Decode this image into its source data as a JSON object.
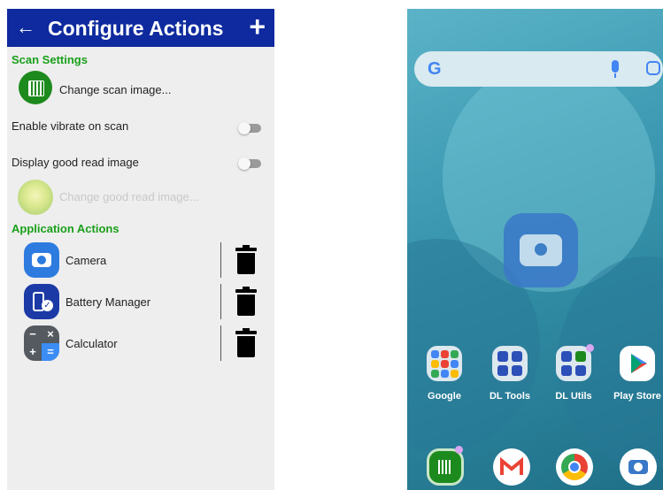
{
  "left_app": {
    "title": "Configure Actions",
    "back_icon": "←",
    "add_icon": "+",
    "scan_settings": {
      "header": "Scan Settings",
      "change_scan_image": "Change scan image...",
      "enable_vibrate": {
        "label": "Enable vibrate on scan",
        "on": false
      },
      "display_good_read": {
        "label": "Display good read image",
        "on": false
      },
      "change_good_read_image": "Change good read image..."
    },
    "application_actions": {
      "header": "Application Actions",
      "items": [
        {
          "label": "Camera",
          "icon": "camera-icon"
        },
        {
          "label": "Battery Manager",
          "icon": "battery-manager-icon"
        },
        {
          "label": "Calculator",
          "icon": "calculator-icon"
        }
      ]
    },
    "colors": {
      "appbar": "#0e2a9e",
      "section_header": "#1aa01a"
    }
  },
  "right_home": {
    "search_logo": "G",
    "apps": [
      {
        "label": "Google"
      },
      {
        "label": "DL Tools"
      },
      {
        "label": "DL Utils"
      },
      {
        "label": "Play Store"
      }
    ],
    "calc_glyphs": [
      "−",
      "×",
      "+",
      "="
    ]
  }
}
